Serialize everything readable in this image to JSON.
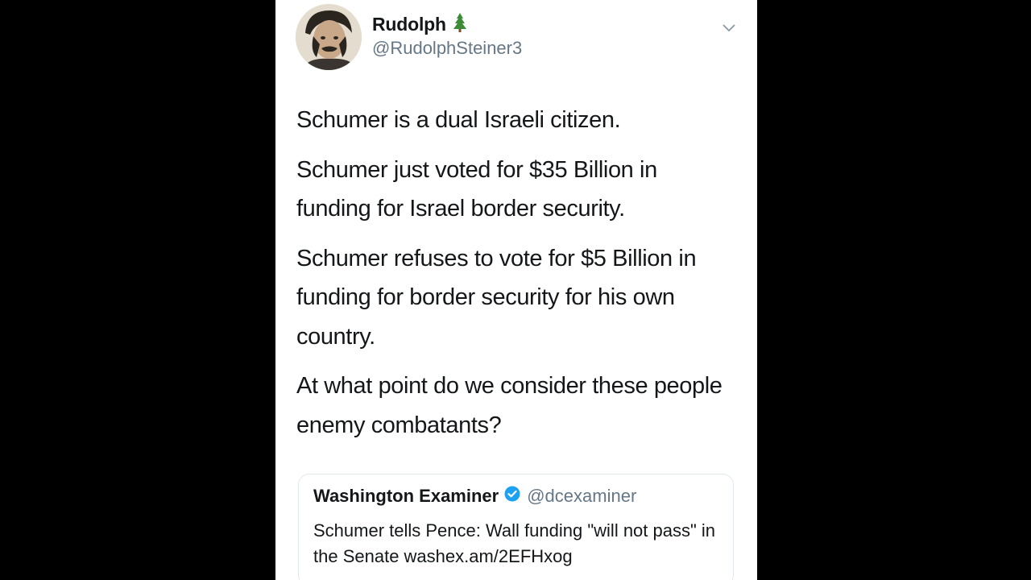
{
  "tweet": {
    "author": {
      "display_name": "Rudolph",
      "name_emoji_icon": "evergreen-tree-icon",
      "handle": "@RudolphSteiner3"
    },
    "menu_icon": "chevron-down-icon",
    "paragraphs": [
      "Schumer is a dual Israeli citizen.",
      "Schumer just voted for $35 Billion in funding for Israel border security.",
      "Schumer refuses to vote for $5 Billion in funding for border security for his own country.",
      "At what point do we consider these people enemy combatants?"
    ],
    "quoted_tweet": {
      "name": "Washington Examiner",
      "verified_icon": "verified-badge-icon",
      "handle": "@dcexaminer",
      "text": "Schumer tells Pence: Wall funding \"will not pass\" in the Senate washex.am/2EFHxog"
    }
  },
  "colors": {
    "background": "#000000",
    "card": "#ffffff",
    "text": "#14171a",
    "muted": "#657786",
    "verified": "#1da1f2",
    "tree": "#3d8b37"
  }
}
